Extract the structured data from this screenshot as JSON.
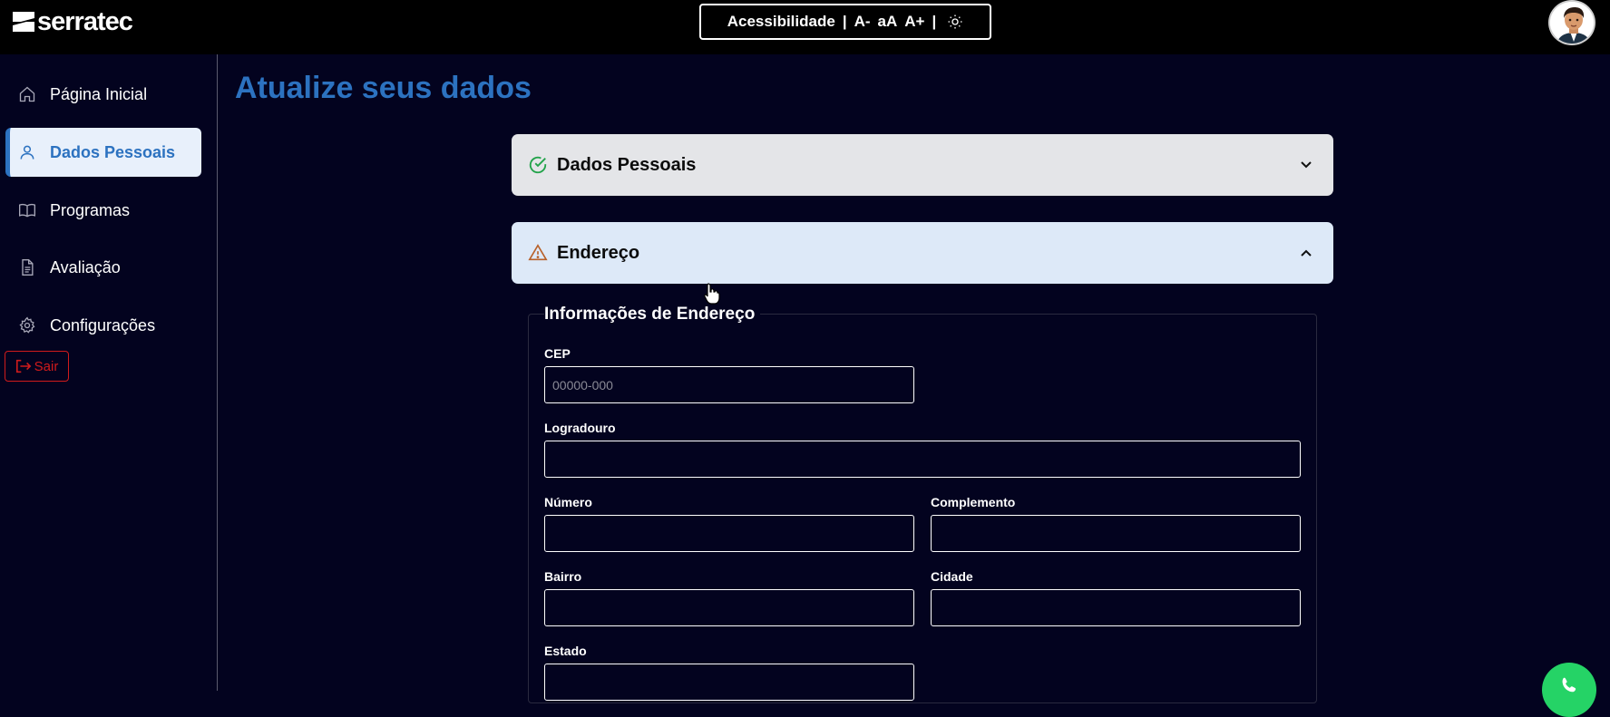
{
  "header": {
    "logo_text": "serratec",
    "accessibility": {
      "label": "Acessibilidade",
      "separator": "|",
      "decrease": "A-",
      "reset": "aA",
      "increase": "A+",
      "theme_icon": "sun-icon"
    },
    "avatar_icon": "user-avatar"
  },
  "sidebar": {
    "items": [
      {
        "label": "Página Inicial",
        "icon": "home-icon",
        "active": false
      },
      {
        "label": "Dados Pessoais",
        "icon": "user-icon",
        "active": true
      },
      {
        "label": "Programas",
        "icon": "book-open-icon",
        "active": false
      },
      {
        "label": "Avaliação",
        "icon": "document-icon",
        "active": false
      },
      {
        "label": "Configurações",
        "icon": "gear-icon",
        "active": false
      }
    ],
    "logout_label": "Sair"
  },
  "main": {
    "title": "Atualize seus dados",
    "sections": [
      {
        "title": "Dados Pessoais",
        "status_icon": "check-circle-icon",
        "expanded": false
      },
      {
        "title": "Endereço",
        "status_icon": "warning-icon",
        "expanded": true
      }
    ],
    "address_form": {
      "legend": "Informações de Endereço",
      "fields": {
        "cep": {
          "label": "CEP",
          "placeholder": "00000-000",
          "value": ""
        },
        "logradouro": {
          "label": "Logradouro",
          "value": ""
        },
        "numero": {
          "label": "Número",
          "value": ""
        },
        "complemento": {
          "label": "Complemento",
          "value": ""
        },
        "bairro": {
          "label": "Bairro",
          "value": ""
        },
        "cidade": {
          "label": "Cidade",
          "value": ""
        },
        "estado": {
          "label": "Estado",
          "value": ""
        }
      }
    }
  },
  "colors": {
    "background": "#03031f",
    "accent": "#2c72c0",
    "success": "#22a34a",
    "warning": "#b8612a",
    "danger": "#d11b1b",
    "whatsapp": "#25d366"
  }
}
